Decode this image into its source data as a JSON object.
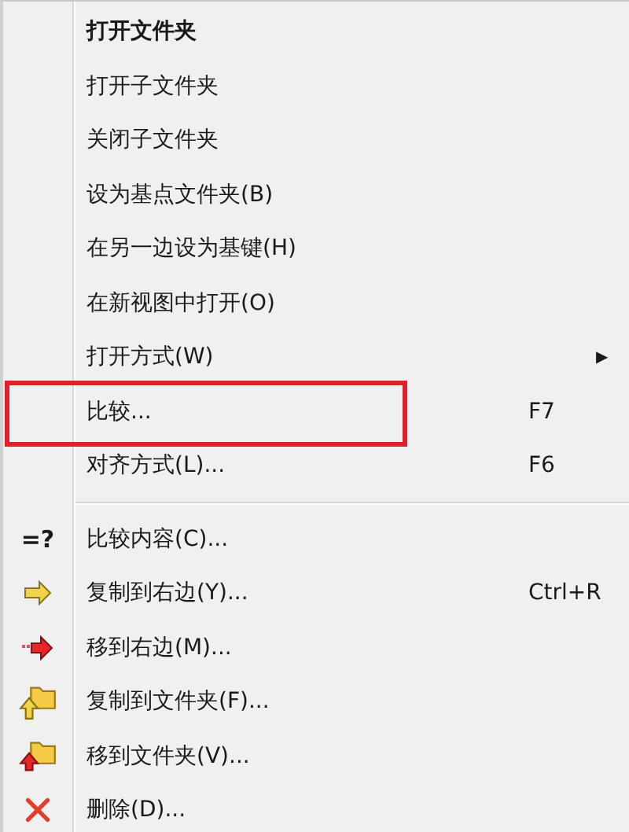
{
  "menu": {
    "items": [
      {
        "kind": "item",
        "label": "打开文件夹",
        "bold": true
      },
      {
        "kind": "item",
        "label": "打开子文件夹",
        "bold": false
      },
      {
        "kind": "item",
        "label": "关闭子文件夹",
        "bold": false
      },
      {
        "kind": "item",
        "label": "设为基点文件夹(B)",
        "bold": false
      },
      {
        "kind": "item",
        "label": "在另一边设为基键(H)",
        "bold": false
      },
      {
        "kind": "item",
        "label": "在新视图中打开(O)",
        "bold": false
      },
      {
        "kind": "item",
        "label": "打开方式(W)",
        "bold": false,
        "submenu": "▶"
      },
      {
        "kind": "item",
        "label": "比较...",
        "bold": false,
        "shortcut": "F7",
        "highlighted": true
      },
      {
        "kind": "item",
        "label": "对齐方式(L)...",
        "bold": false,
        "shortcut": "F6",
        "highlighted": false
      },
      {
        "kind": "separator"
      },
      {
        "kind": "item",
        "label": "比较内容(C)...",
        "bold": false,
        "icon_text": "=?"
      },
      {
        "kind": "icon-item",
        "label": "复制到右边(Y)...",
        "bold": false,
        "shortcut": "Ctrl+R"
      },
      {
        "kind": "icon-item",
        "label": "移到右边(M)...",
        "bold": false
      },
      {
        "kind": "icon-item",
        "label": "复制到文件夹(F)...",
        "bold": false
      },
      {
        "kind": "icon-item",
        "label": "移到文件夹(V)...",
        "bold": false
      },
      {
        "kind": "icon-item",
        "label": "删除(D)...",
        "bold": false
      }
    ]
  }
}
